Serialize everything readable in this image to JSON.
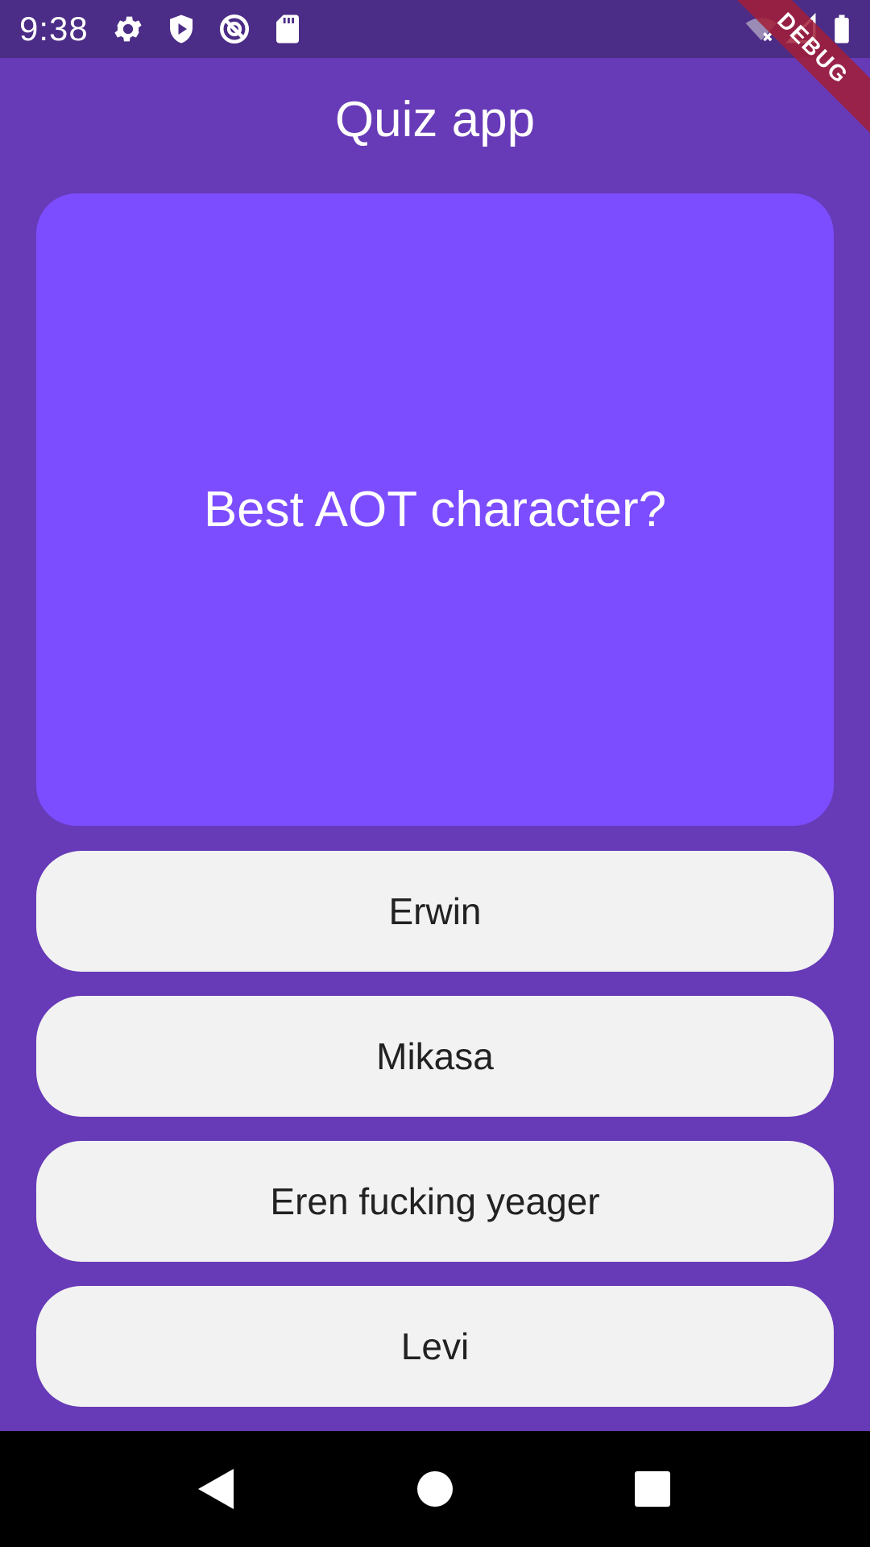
{
  "status_bar": {
    "time": "9:38",
    "icons_left": [
      "gear-icon",
      "shield-play-icon",
      "no-disturb-icon",
      "sd-card-icon"
    ],
    "icons_right": [
      "wifi-off-icon",
      "signal-icon",
      "battery-icon"
    ]
  },
  "debug_banner": {
    "label": "DEBUG"
  },
  "app_bar": {
    "title": "Quiz app"
  },
  "question": {
    "text": "Best AOT character?"
  },
  "answers": [
    {
      "label": "Erwin"
    },
    {
      "label": "Mikasa"
    },
    {
      "label": "Eren fucking yeager"
    },
    {
      "label": "Levi"
    }
  ],
  "nav_bar": {
    "buttons": [
      "back-icon",
      "home-icon",
      "recents-icon"
    ]
  },
  "colors": {
    "background": "#673ab7",
    "status_bar": "#4b2c86",
    "question_card": "#7c4dff",
    "answer_button": "#f2f2f2",
    "debug_banner": "#a21e37"
  }
}
